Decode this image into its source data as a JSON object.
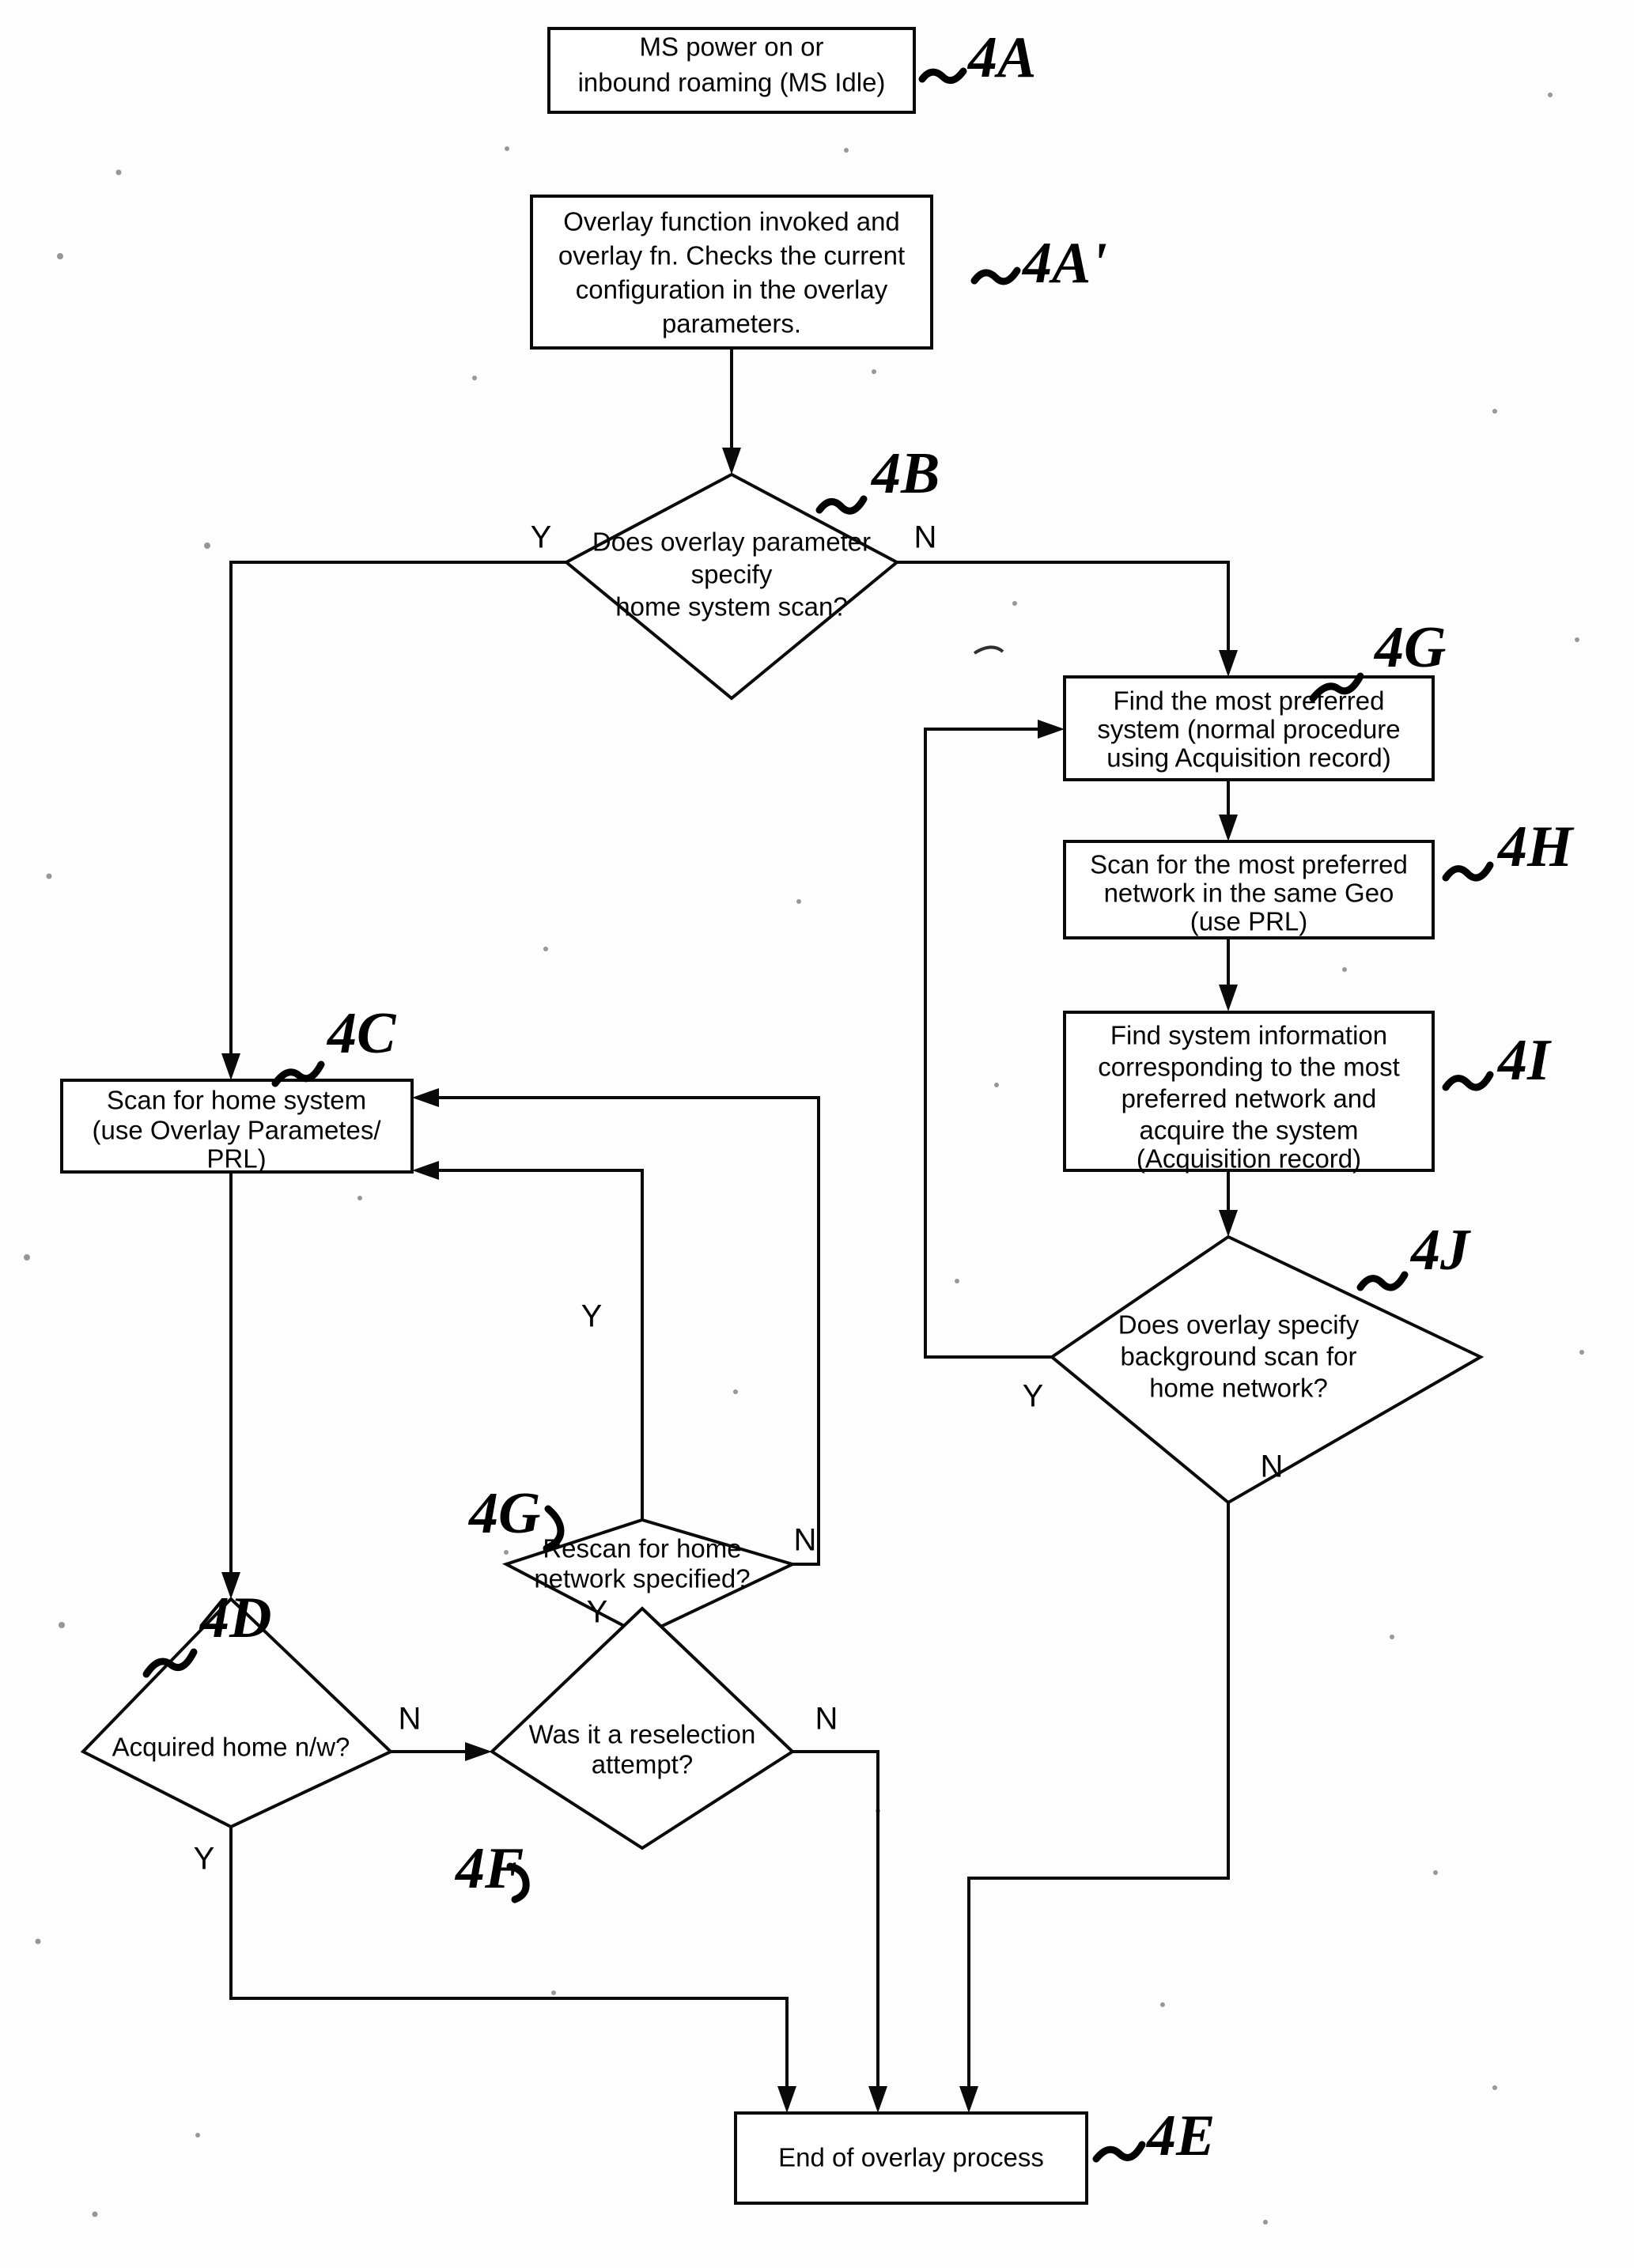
{
  "figure": {
    "type": "flowchart",
    "title": "Overlay network scan process flowchart",
    "nodes": [
      {
        "id": "4A",
        "ref": "4A",
        "shape": "process",
        "text_lines": [
          "MS power on or",
          "inbound roaming (MS Idle)"
        ]
      },
      {
        "id": "4A1",
        "ref": "4A'",
        "shape": "process",
        "text_lines": [
          "Overlay function invoked and",
          "overlay fn. Checks the current",
          "configuration in the overlay",
          "parameters."
        ]
      },
      {
        "id": "4B",
        "ref": "4B",
        "shape": "decision",
        "text_lines": [
          "Does overlay parameter",
          "specify",
          "home system scan?"
        ],
        "yes_label": "Y",
        "no_label": "N"
      },
      {
        "id": "4G_box",
        "ref": "4G",
        "shape": "process",
        "text_lines": [
          "Find the most preferred",
          "system (normal procedure",
          "using Acquisition record)"
        ]
      },
      {
        "id": "4H",
        "ref": "4H",
        "shape": "process",
        "text_lines": [
          "Scan for the most preferred",
          "network in the same Geo",
          "(use PRL)"
        ]
      },
      {
        "id": "4I",
        "ref": "4I",
        "shape": "process",
        "text_lines": [
          "Find system information",
          "corresponding to the most",
          "preferred network and",
          "acquire the system",
          "(Acquisition record)"
        ]
      },
      {
        "id": "4J",
        "ref": "4J",
        "shape": "decision",
        "text_lines": [
          "Does overlay specify",
          "background scan for",
          "home network?"
        ],
        "yes_label": "Y",
        "no_label": "N"
      },
      {
        "id": "4C",
        "ref": "4C",
        "shape": "process",
        "text_lines": [
          "Scan for home system",
          "(use Overlay Parametes/",
          "PRL)"
        ]
      },
      {
        "id": "4G_dia",
        "ref": "4G",
        "shape": "decision",
        "text_lines": [
          "Rescan for home",
          "network specified?"
        ],
        "yes_label": "Y",
        "no_label": "N"
      },
      {
        "id": "4D",
        "ref": "4D",
        "shape": "decision",
        "text_lines": [
          "Acquired home n/w?"
        ],
        "yes_label": "Y",
        "no_label": "N"
      },
      {
        "id": "4F",
        "ref": "4F",
        "shape": "decision",
        "text_lines": [
          "Was it a reselection",
          "attempt?"
        ],
        "yes_label": "Y",
        "no_label": "N"
      },
      {
        "id": "4E",
        "ref": "4E",
        "shape": "process",
        "text_lines": [
          "End of overlay process"
        ]
      }
    ],
    "reference_numerals": [
      "4A",
      "4A'",
      "4B",
      "4C",
      "4D",
      "4E",
      "4F",
      "4G",
      "4G",
      "4H",
      "4I",
      "4J"
    ],
    "branch_labels": [
      "Y",
      "N"
    ],
    "colors": {
      "line": "#0a0a0a",
      "fill": "#ffffff",
      "background": "#fdfdfd"
    }
  }
}
